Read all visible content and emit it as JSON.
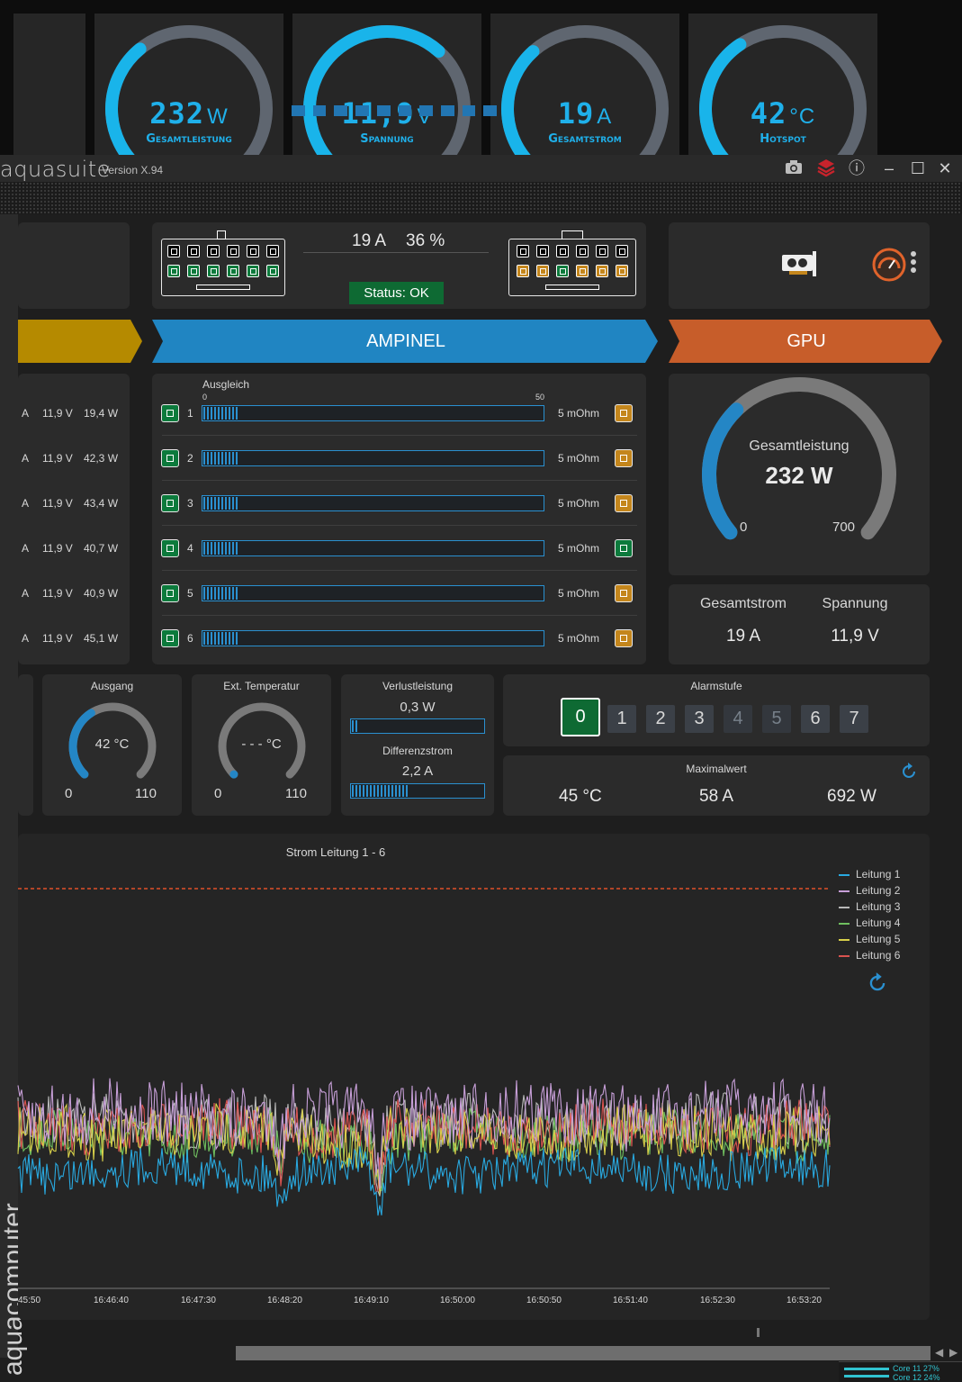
{
  "overlays": [
    {
      "value": "232",
      "unit": "W",
      "label": "Gesamtleistung",
      "min": "0",
      "max": "650",
      "fraction": 0.36
    },
    {
      "value": "11,9",
      "unit": "V",
      "label": "Spannung",
      "min": "8",
      "max": "14",
      "fraction": 0.65
    },
    {
      "value": "19",
      "unit": "A",
      "label": "Gesamtstrom",
      "min": "0",
      "max": "55",
      "fraction": 0.35
    },
    {
      "value": "42",
      "unit": "°C",
      "label": "Hotspot",
      "min": "0",
      "max": "110",
      "fraction": 0.38
    }
  ],
  "titlebar": {
    "app_name": "aquasuite",
    "version": "Version X.94",
    "icons": [
      "camera-icon",
      "layers-icon",
      "info-icon",
      "minimize-icon",
      "maximize-icon",
      "close-icon"
    ],
    "minimize": "–",
    "maximize": "☐",
    "close": "✕",
    "info": "ⓘ"
  },
  "header": {
    "current": "19 A",
    "percent": "36 %",
    "status": "Status: OK",
    "segments_filled": 10
  },
  "banners": {
    "left": "",
    "center": "AMPINEL",
    "right": "GPU"
  },
  "left_rows": [
    {
      "a": "A",
      "v": "11,9 V",
      "w": "19,4 W"
    },
    {
      "a": "A",
      "v": "11,9 V",
      "w": "42,3 W"
    },
    {
      "a": "A",
      "v": "11,9 V",
      "w": "43,4 W"
    },
    {
      "a": "A",
      "v": "11,9 V",
      "w": "40,7 W"
    },
    {
      "a": "A",
      "v": "11,9 V",
      "w": "40,9 W"
    },
    {
      "a": "A",
      "v": "11,9 V",
      "w": "45,1 W"
    }
  ],
  "ampinel": {
    "title": "Ausgleich",
    "scale_min": "0",
    "scale_max": "50",
    "rows": [
      {
        "n": "1",
        "res": "5 mOhm",
        "fill": 0.105,
        "right_chip": "orange"
      },
      {
        "n": "2",
        "res": "5 mOhm",
        "fill": 0.105,
        "right_chip": "orange"
      },
      {
        "n": "3",
        "res": "5 mOhm",
        "fill": 0.105,
        "right_chip": "orange"
      },
      {
        "n": "4",
        "res": "5 mOhm",
        "fill": 0.105,
        "right_chip": "green"
      },
      {
        "n": "5",
        "res": "5 mOhm",
        "fill": 0.105,
        "right_chip": "orange"
      },
      {
        "n": "6",
        "res": "5 mOhm",
        "fill": 0.105,
        "right_chip": "orange"
      }
    ]
  },
  "gpu": {
    "gauge_label": "Gesamtleistung",
    "gauge_value": "232 W",
    "gauge_min": "0",
    "gauge_max": "700",
    "fraction": 0.33,
    "gesamtstrom_label": "Gesamtstrom",
    "gesamtstrom": "19 A",
    "spannung_label": "Spannung",
    "spannung": "11,9 V"
  },
  "ausgang": {
    "label": "Ausgang",
    "value": "42 °C",
    "min": "0",
    "max": "110",
    "fraction": 0.38
  },
  "ext_temp": {
    "label": "Ext. Temperatur",
    "value": "- - - °C",
    "min": "0",
    "max": "110",
    "fraction": 0.0
  },
  "verlust": {
    "label": "Verlustleistung",
    "value": "0,3 W",
    "fill": 0.04,
    "diff_label": "Differenzstrom",
    "diff_value": "2,2 A",
    "diff_fill": 0.43
  },
  "alarm": {
    "label": "Alarmstufe",
    "levels": [
      "0",
      "1",
      "2",
      "3",
      "4",
      "5",
      "6",
      "7"
    ],
    "selected": "0",
    "dimmed": [
      "4",
      "5"
    ]
  },
  "maximalwert": {
    "label": "Maximalwert",
    "temp": "45 °C",
    "current": "58 A",
    "power": "692 W"
  },
  "graph": {
    "title": "Strom Leitung 1 - 6",
    "legend": [
      {
        "name": "Leitung 1",
        "color": "#29a9e0"
      },
      {
        "name": "Leitung 2",
        "color": "#c79fd8"
      },
      {
        "name": "Leitung 3",
        "color": "#b8b8b8"
      },
      {
        "name": "Leitung 4",
        "color": "#6fbf5f"
      },
      {
        "name": "Leitung 5",
        "color": "#d8d04a"
      },
      {
        "name": "Leitung 6",
        "color": "#d9534f"
      }
    ],
    "xticks": [
      "45:50",
      "16:46:40",
      "16:47:30",
      "16:48:20",
      "16:49:10",
      "16:50:00",
      "16:50:50",
      "16:51:40",
      "16:52:30",
      "16:53:20"
    ],
    "limit_color": "#e0502a"
  },
  "rail_brand": "aquacomputer",
  "tray": {
    "line1": "Core 11   27%",
    "line2": "Core 12   24%"
  }
}
